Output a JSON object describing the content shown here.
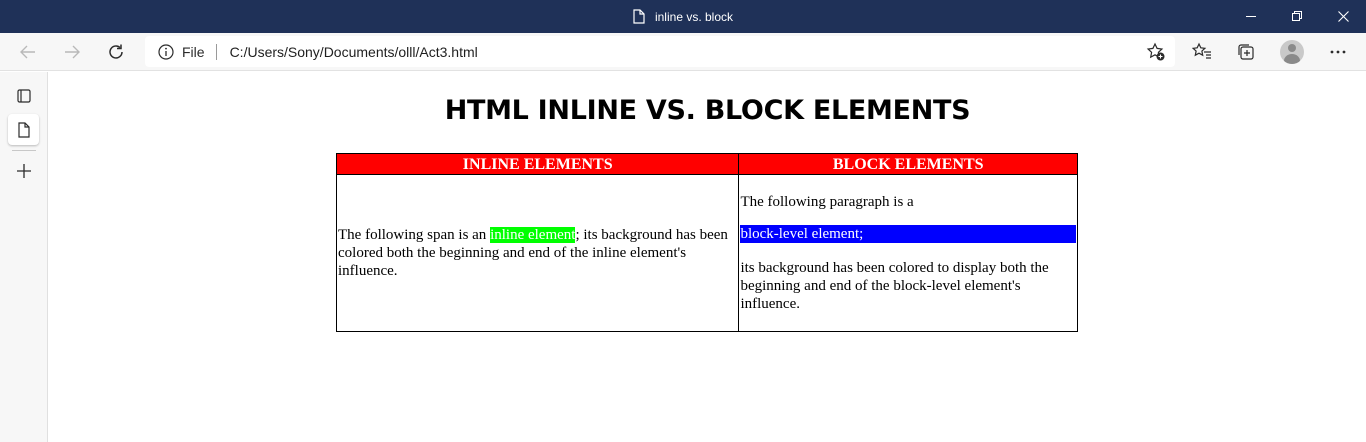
{
  "window": {
    "title": "inline vs. block"
  },
  "toolbar": {
    "back_icon": "arrow-left-icon",
    "forward_icon": "arrow-right-icon",
    "refresh_icon": "refresh-icon",
    "address": {
      "scheme_label": "File",
      "url": "C:/Users/Sony/Documents/olll/Act3.html"
    }
  },
  "page": {
    "heading": "HTML INLINE VS. BLOCK ELEMENTS",
    "table": {
      "headers": [
        "INLINE ELEMENTS",
        "BLOCK ELEMENTS"
      ],
      "inline_cell": {
        "before": "The following span is an ",
        "highlight": "inline element",
        "after": "; its background has been colored both the beginning and end of the inline element's influence."
      },
      "block_cell": {
        "intro": "The following paragraph is a",
        "highlight": "block-level element;",
        "after": "its background has been colored to display both the beginning and end of the block-level element's influence."
      }
    }
  },
  "colors": {
    "titlebar": "#1f3158",
    "header_bg": "#ff0000",
    "inline_highlight": "#00ff00",
    "block_highlight": "#0000ff"
  }
}
